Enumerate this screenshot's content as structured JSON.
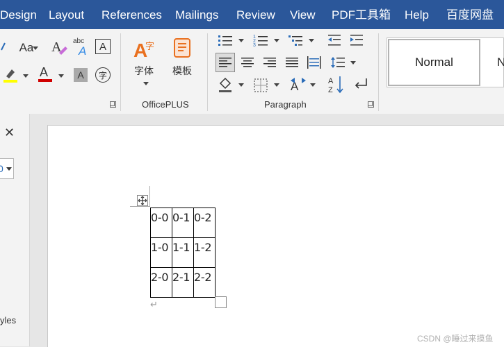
{
  "tabs": [
    "Design",
    "Layout",
    "References",
    "Mailings",
    "Review",
    "View",
    "PDF工具箱",
    "Help",
    "百度网盘"
  ],
  "font_group": {
    "change_case": "Aa",
    "abc_label": "abc"
  },
  "officeplus": {
    "group_label": "OfficePLUS",
    "font_button": "字体",
    "template_button": "模板"
  },
  "paragraph": {
    "group_label": "Paragraph"
  },
  "styles": {
    "normal": "Normal",
    "next": "N"
  },
  "left_pane": {
    "close": "✕",
    "dropdown_value": "0",
    "label": "yles"
  },
  "document": {
    "table": [
      [
        "0-0",
        "0-1",
        "0-2"
      ],
      [
        "1-0",
        "1-1",
        "1-2"
      ],
      [
        "2-0",
        "2-1",
        "2-2"
      ]
    ],
    "paragraph_mark": "↵"
  },
  "watermark": "CSDN @睡过来摸鱼",
  "colors": {
    "tab_bar": "#2b579a",
    "highlight": "#ffff00",
    "font_color": "#d00000",
    "ribbon": "#f3f3f3"
  }
}
